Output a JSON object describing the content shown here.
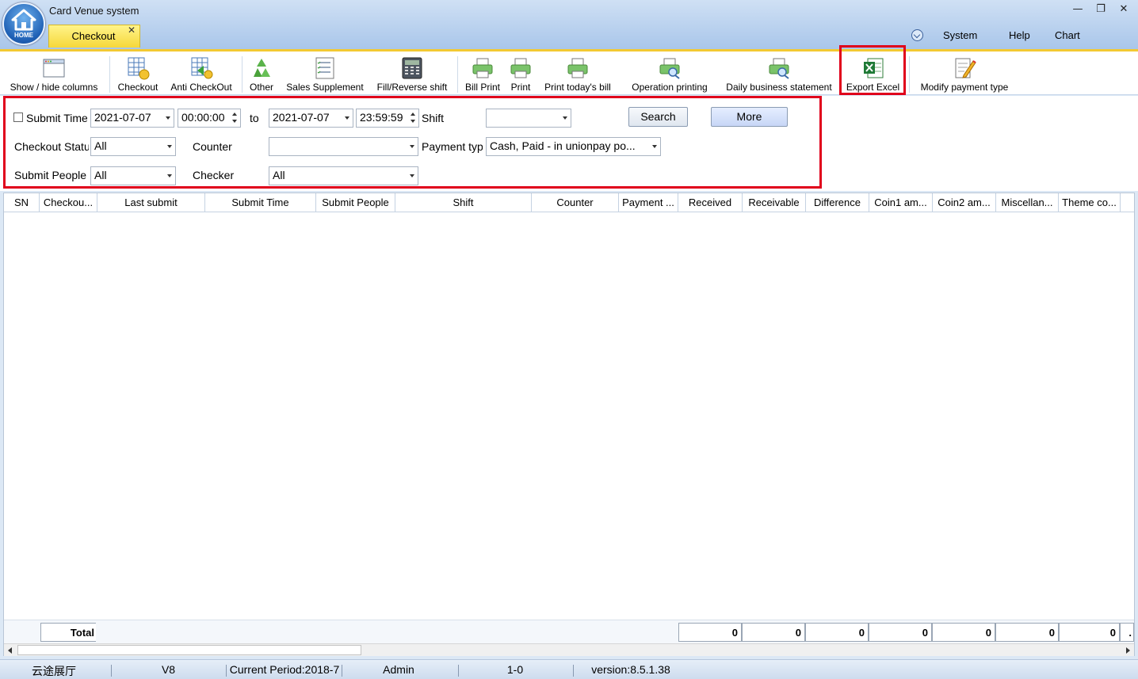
{
  "window": {
    "title": "Card Venue system",
    "home_label": "HOME",
    "active_tab": "Checkout",
    "tab_close": "✕",
    "menu": [
      "System",
      "Help",
      "Chart"
    ],
    "controls": {
      "minimize": "—",
      "restore": "❐",
      "close": "✕"
    }
  },
  "toolbar": {
    "show_hide_columns": "Show / hide columns",
    "checkout": "Checkout",
    "anti_checkout": "Anti CheckOut",
    "other": "Other",
    "sales_supplement": "Sales Supplement",
    "fill_reverse_shift": "Fill/Reverse shift",
    "bill_print": "Bill Print",
    "print": "Print",
    "print_todays_bill": "Print today's bill",
    "operation_printing": "Operation printing",
    "daily_business_statement": "Daily business statement",
    "export_excel": "Export Excel",
    "modify_payment_type": "Modify payment type"
  },
  "filters": {
    "submit_time_label": "Submit Time",
    "start_date": "2021-07-07",
    "start_time": "00:00:00",
    "to_label": "to",
    "end_date": "2021-07-07",
    "end_time": "23:59:59",
    "shift_label": "Shift",
    "shift_value": "",
    "search_button": "Search",
    "more_button": "More",
    "checkout_status_label": "Checkout Status",
    "checkout_status_value": "All",
    "counter_label": "Counter",
    "counter_value": "",
    "payment_type_label": "Payment type",
    "payment_type_value": "Cash, Paid - in unionpay po...",
    "submit_people_label": "Submit People",
    "submit_people_value": "All",
    "checker_label": "Checker",
    "checker_value": "All"
  },
  "grid": {
    "columns": [
      "SN",
      "Checkou...",
      "Last submit",
      "Submit Time",
      "Submit People",
      "Shift",
      "Counter",
      "Payment ...",
      "Received",
      "Receivable",
      "Difference",
      "Coin1 am...",
      "Coin2 am...",
      "Miscellan...",
      "Theme co..."
    ],
    "total_label": "Total",
    "totals": [
      "0",
      "0",
      "0",
      "0",
      "0",
      "0",
      "0",
      "."
    ]
  },
  "statusbar": {
    "venue": "云途展厅",
    "version_short": "V8",
    "period": "Current Period:2018-7",
    "user": "Admin",
    "code": "1-0",
    "version": "version:8.5.1.38"
  }
}
